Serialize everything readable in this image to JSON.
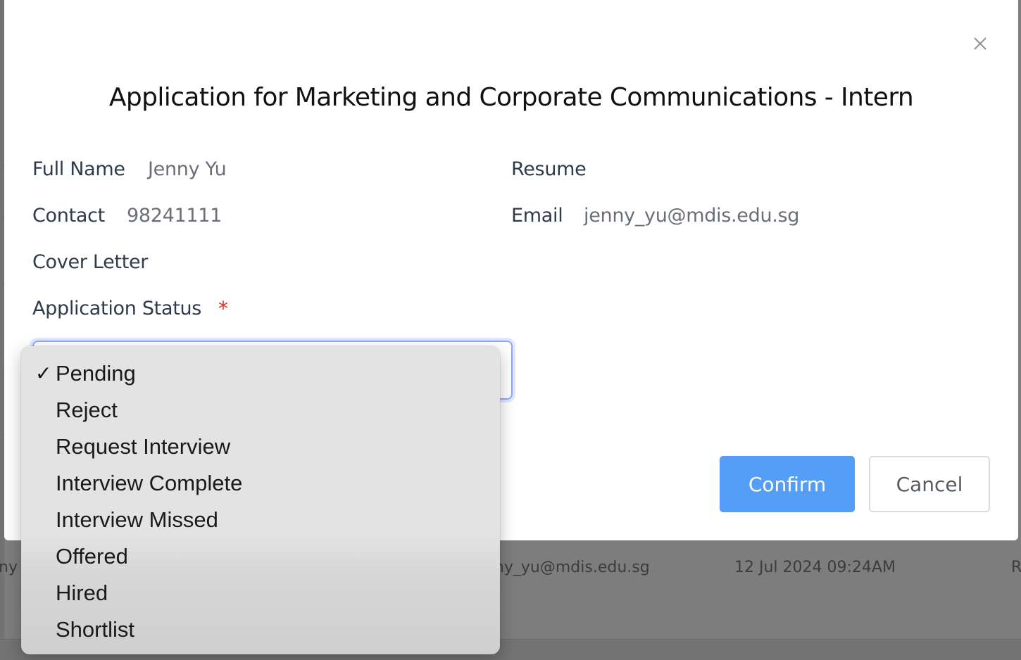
{
  "modal": {
    "title": "Application for Marketing and Corporate Communications - Intern",
    "fields": {
      "full_name_label": "Full Name",
      "full_name_value": "Jenny Yu",
      "resume_label": "Resume",
      "contact_label": "Contact",
      "contact_value": "98241111",
      "email_label": "Email",
      "email_value": "jenny_yu@mdis.edu.sg",
      "cover_letter_label": "Cover Letter",
      "application_status_label": "Application Status",
      "required_mark": "*"
    },
    "buttons": {
      "confirm": "Confirm",
      "cancel": "Cancel"
    },
    "close_icon": "close-icon"
  },
  "status_dropdown": {
    "selected": "Pending",
    "check_mark": "✓",
    "options": [
      "Pending",
      "Reject",
      "Request Interview",
      "Interview Complete",
      "Interview Missed",
      "Offered",
      "Hired",
      "Shortlist"
    ]
  },
  "background_table": {
    "name_fragment": "ny Y",
    "email_fragment": "nny_yu@mdis.edu.sg",
    "date": "12 Jul 2024 09:24AM",
    "last_col_fragment": "R"
  },
  "colors": {
    "confirm_button": "#559ef7",
    "required_star": "#d93025",
    "select_focus_border": "#8ea8ff",
    "overlay": "#7d7d7d"
  }
}
